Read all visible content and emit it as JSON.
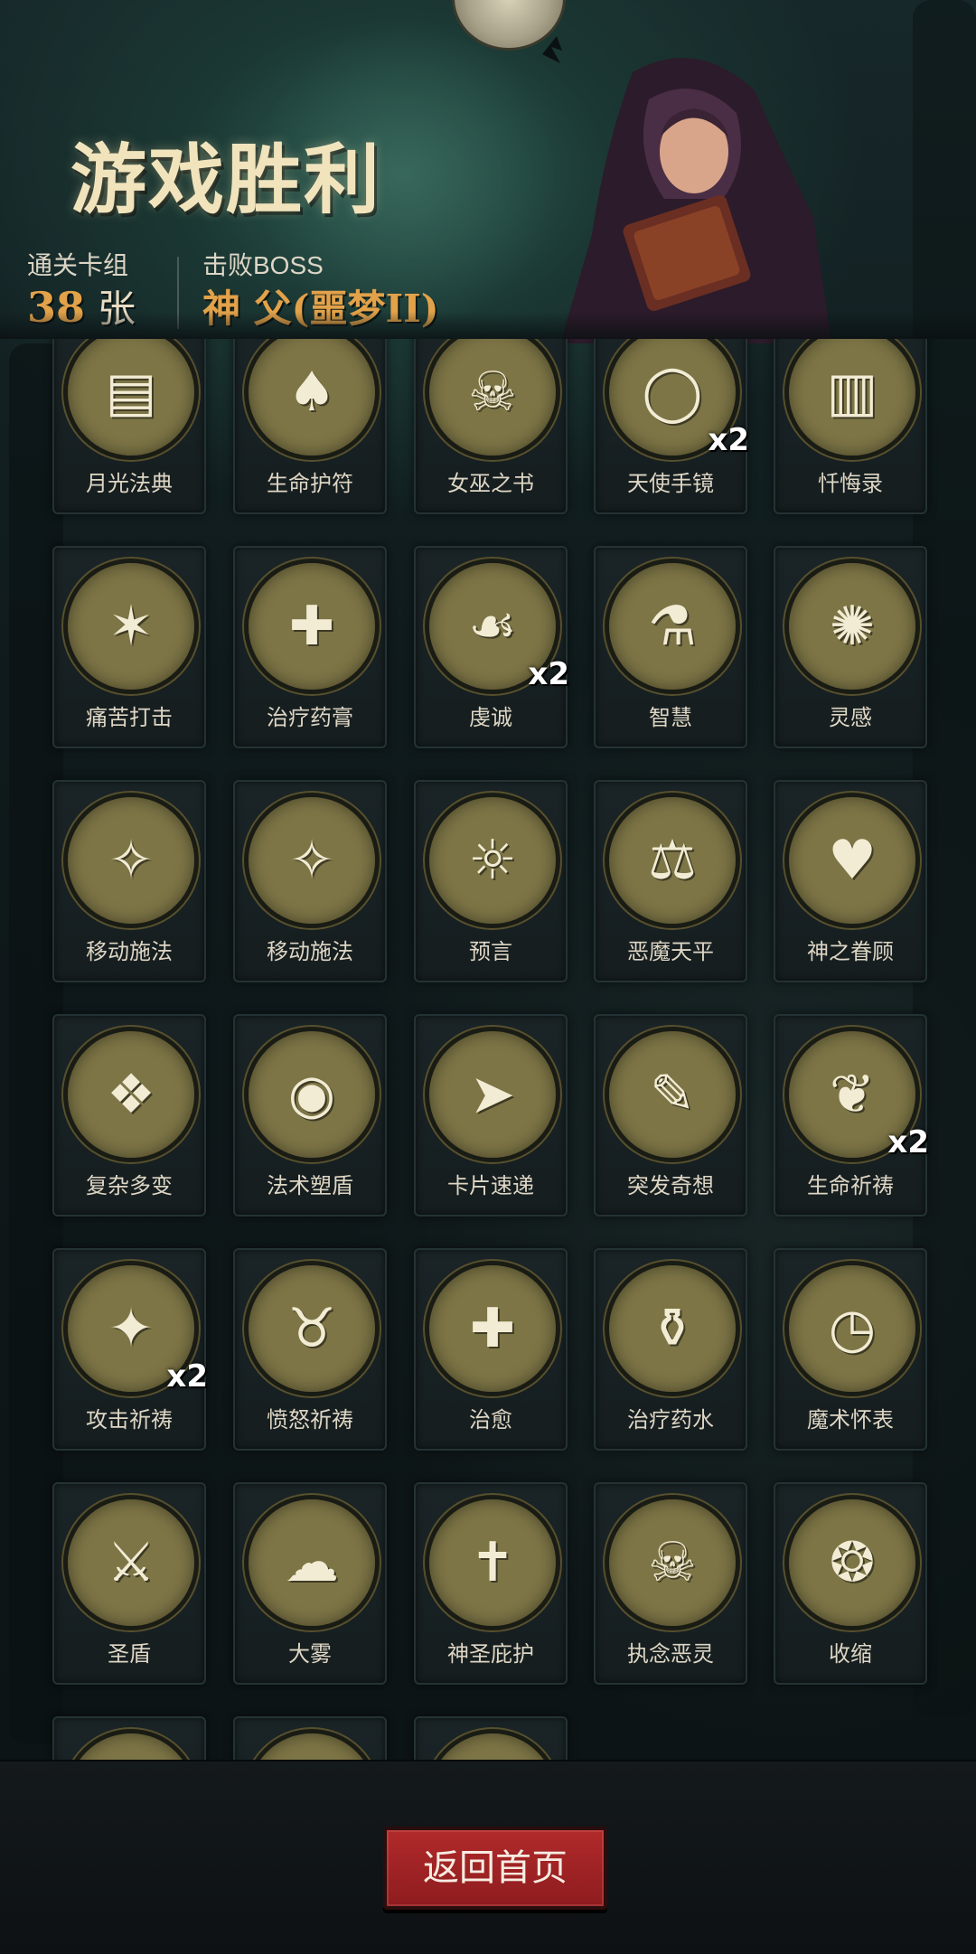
{
  "header": {
    "title": "游戏胜利",
    "deck_label": "通关卡组",
    "deck_count": "38",
    "deck_unit": "张",
    "boss_label": "击败BOSS",
    "boss_name": "神 父(噩梦II)"
  },
  "cards": [
    {
      "name": "月光法典",
      "icon": "book-icon",
      "glyph": "▤",
      "mult": ""
    },
    {
      "name": "生命护符",
      "icon": "bat-amulet-icon",
      "glyph": "♠",
      "mult": ""
    },
    {
      "name": "女巫之书",
      "icon": "skull-book-icon",
      "glyph": "☠",
      "mult": ""
    },
    {
      "name": "天使手镜",
      "icon": "hand-mirror-icon",
      "glyph": "◯",
      "mult": "x2"
    },
    {
      "name": "忏悔录",
      "icon": "open-book-icon",
      "glyph": "▥",
      "mult": ""
    },
    {
      "name": "痛苦打击",
      "icon": "strike-icon",
      "glyph": "✶",
      "mult": ""
    },
    {
      "name": "治疗药膏",
      "icon": "ointment-tube-icon",
      "glyph": "✚",
      "mult": ""
    },
    {
      "name": "虔诚",
      "icon": "praying-nun-icon",
      "glyph": "☙",
      "mult": "x2"
    },
    {
      "name": "智慧",
      "icon": "old-scholar-icon",
      "glyph": "⚗",
      "mult": ""
    },
    {
      "name": "灵感",
      "icon": "brain-skull-icon",
      "glyph": "✺",
      "mult": ""
    },
    {
      "name": "移动施法",
      "icon": "wizard-icon",
      "glyph": "✧",
      "mult": ""
    },
    {
      "name": "移动施法",
      "icon": "wizard-icon",
      "glyph": "✧",
      "mult": ""
    },
    {
      "name": "预言",
      "icon": "old-prophet-icon",
      "glyph": "☼",
      "mult": ""
    },
    {
      "name": "恶魔天平",
      "icon": "demon-scale-icon",
      "glyph": "⚖",
      "mult": ""
    },
    {
      "name": "神之眷顾",
      "icon": "angel-heart-icon",
      "glyph": "♥",
      "mult": ""
    },
    {
      "name": "复杂多变",
      "icon": "cube-tentacle-icon",
      "glyph": "❖",
      "mult": ""
    },
    {
      "name": "法术塑盾",
      "icon": "shield-bubble-icon",
      "glyph": "◉",
      "mult": ""
    },
    {
      "name": "卡片速递",
      "icon": "flying-card-icon",
      "glyph": "➤",
      "mult": ""
    },
    {
      "name": "突发奇想",
      "icon": "lightbulb-icon",
      "glyph": "✎",
      "mult": ""
    },
    {
      "name": "生命祈祷",
      "icon": "sprout-icon",
      "glyph": "❦",
      "mult": "x2"
    },
    {
      "name": "攻击祈祷",
      "icon": "crossbow-icon",
      "glyph": "✦",
      "mult": "x2"
    },
    {
      "name": "愤怒祈祷",
      "icon": "angry-bull-icon",
      "glyph": "♉",
      "mult": ""
    },
    {
      "name": "治愈",
      "icon": "healing-plant-icon",
      "glyph": "✚",
      "mult": ""
    },
    {
      "name": "治疗药水",
      "icon": "zombie-potion-icon",
      "glyph": "⚱",
      "mult": ""
    },
    {
      "name": "魔术怀表",
      "icon": "pocket-watch-icon",
      "glyph": "◷",
      "mult": ""
    },
    {
      "name": "圣盾",
      "icon": "holy-warrior-icon",
      "glyph": "⚔",
      "mult": ""
    },
    {
      "name": "大雾",
      "icon": "fog-beast-icon",
      "glyph": "☁",
      "mult": ""
    },
    {
      "name": "神圣庇护",
      "icon": "cross-shield-icon",
      "glyph": "✝",
      "mult": ""
    },
    {
      "name": "执念恶灵",
      "icon": "ghost-icon",
      "glyph": "☠",
      "mult": ""
    },
    {
      "name": "收缩",
      "icon": "shrinking-man-icon",
      "glyph": "❂",
      "mult": ""
    },
    {
      "name": "",
      "icon": "orc-icon",
      "glyph": "☗",
      "mult": ""
    },
    {
      "name": "",
      "icon": "vortex-icon",
      "glyph": "◎",
      "mult": ""
    },
    {
      "name": "",
      "icon": "wizard-bat-icon",
      "glyph": "✧",
      "mult": ""
    }
  ],
  "footer": {
    "home_button": "返回首页"
  },
  "colors": {
    "accent_gold": "#e2a24a",
    "button_red": "#a82427",
    "card_art_bg": "#7d7546"
  }
}
